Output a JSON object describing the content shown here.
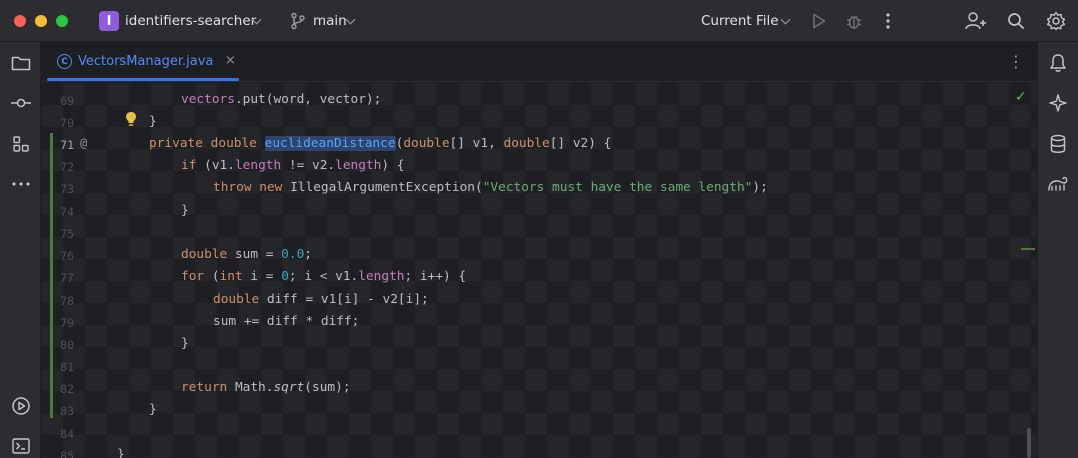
{
  "titlebar": {
    "project_initial": "I",
    "project_name": "identifiers-searcher",
    "branch_name": "main",
    "run_config": "Current File"
  },
  "icons": {
    "folder": "folder-icon",
    "commit": "commit-icon",
    "structure": "structure-icon",
    "more_tools": "more-tools-icon",
    "services": "services-icon",
    "terminal": "terminal-icon",
    "notifications": "bell-icon",
    "ai_assistant": "sparkle-icon",
    "database": "database-icon",
    "gradle": "gradle-icon",
    "run": "run-icon",
    "debug": "debug-icon",
    "more_actions": "more-actions-icon",
    "add_user": "add-user-icon",
    "search": "search-icon",
    "settings": "gear-icon"
  },
  "tab": {
    "file_icon_letter": "C",
    "file_name": "VectorsManager.java",
    "close_glyph": "×",
    "menu_glyph": "⋮"
  },
  "editor": {
    "line_numbers": [
      "69",
      "70",
      "71",
      "72",
      "73",
      "74",
      "75",
      "76",
      "77",
      "78",
      "79",
      "80",
      "81",
      "82",
      "83",
      "84",
      "85"
    ],
    "current_line": "71",
    "annotation_marker": "@",
    "lines": {
      "l69": {
        "obj": "vectors",
        "rest": ".put(word, vector);"
      },
      "l70": {
        "text": "}"
      },
      "l71": {
        "kw1": "private",
        "kw2": "double",
        "fn": "euclideanDistance",
        "p1": "(",
        "kw3": "double",
        "p2": "[] v1, ",
        "kw4": "double",
        "p3": "[] v2) {"
      },
      "l72": {
        "kw": "if",
        "a": " (v1.",
        "f1": "length",
        "b": " != v2.",
        "f2": "length",
        "c": ") {"
      },
      "l73": {
        "kw1": "throw",
        "kw2": "new",
        "cls": " IllegalArgumentException(",
        "str": "\"Vectors must have the same length\"",
        "end": ");"
      },
      "l74": {
        "text": "}"
      },
      "l76": {
        "kw": "double",
        "a": " sum = ",
        "num": "0.0",
        "end": ";"
      },
      "l77": {
        "kw1": "for",
        "a": " (",
        "kw2": "int",
        "b": " i = ",
        "num": "0",
        "c": "; i < v1.",
        "f": "length",
        "d": "; i++) {"
      },
      "l78": {
        "kw": "double",
        "rest": " diff = v1[i] - v2[i];"
      },
      "l79": {
        "text": "sum += diff * diff;"
      },
      "l80": {
        "text": "}"
      },
      "l82": {
        "kw": "return",
        "a": " Math.",
        "fn": "sqrt",
        "end": "(sum);"
      },
      "l83": {
        "text": "}"
      },
      "l85": {
        "text": "}"
      }
    }
  },
  "colors": {
    "accent": "#3574f0",
    "project_badge": "#8f5cde",
    "keyword": "#cf8e6d",
    "function": "#56a8f5",
    "string": "#6aab73",
    "number": "#2aacb8",
    "field": "#c77dbb",
    "vcs_added": "#4a7a3c"
  }
}
